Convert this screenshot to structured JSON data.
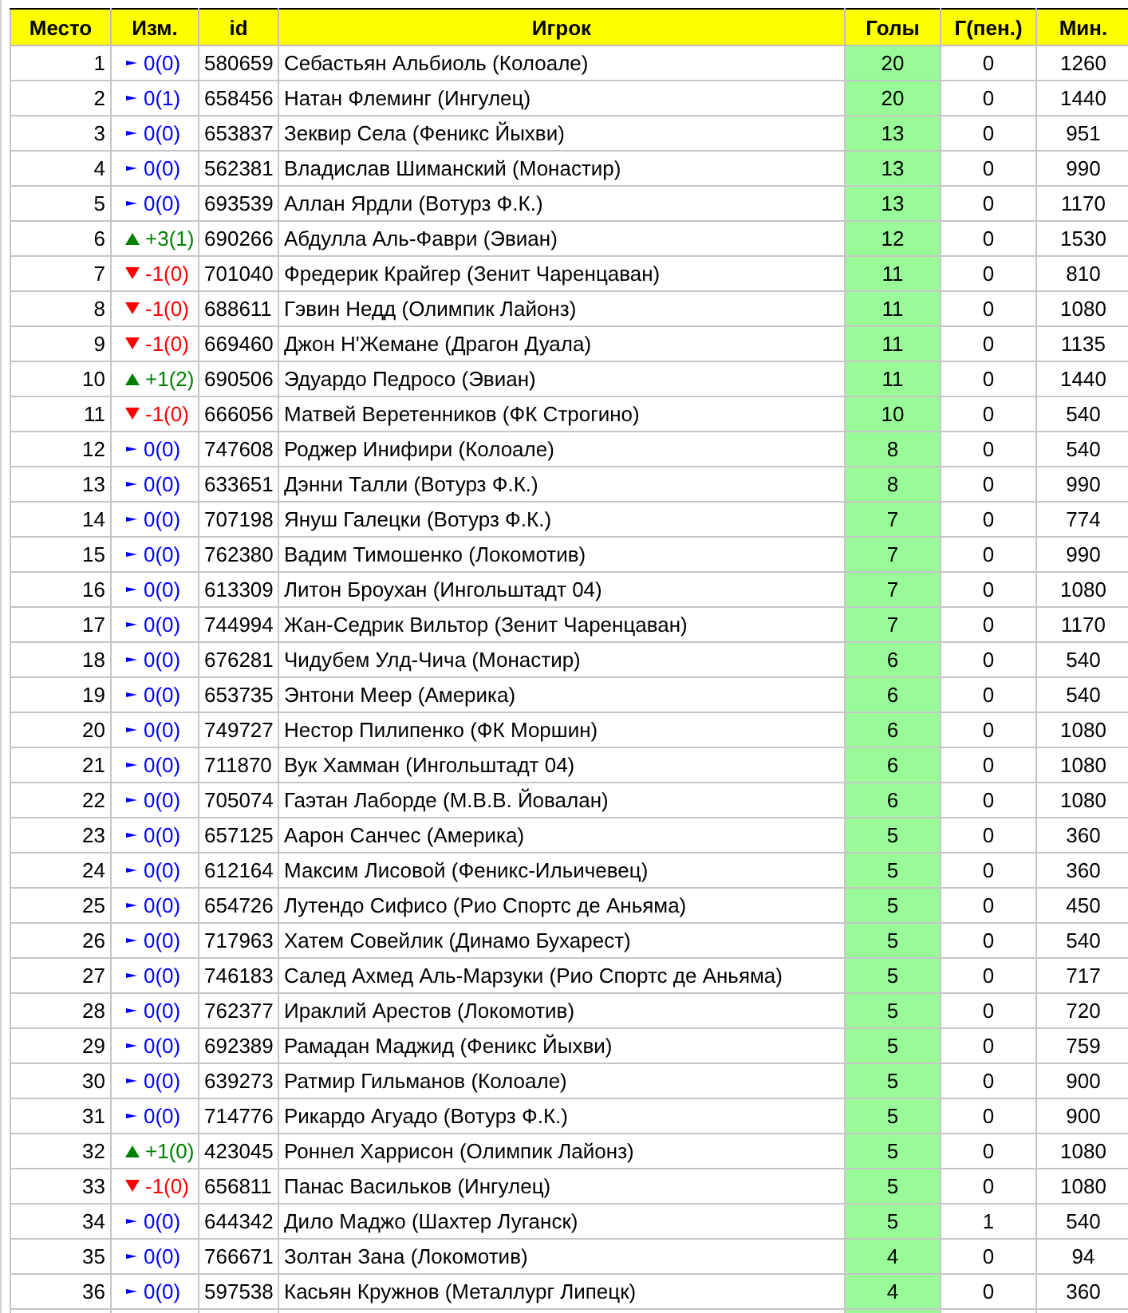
{
  "table": {
    "columns": [
      "Место",
      "Изм.",
      "id",
      "Игрок",
      "Голы",
      "Г(пен.)",
      "Мин."
    ],
    "rows": [
      {
        "place": "1",
        "change": {
          "kind": "same",
          "text": "0(0)"
        },
        "id": "580659",
        "player": "Себастьян Альбиоль (Колоале)",
        "goals": "20",
        "pen": "0",
        "min": "1260"
      },
      {
        "place": "2",
        "change": {
          "kind": "same",
          "text": "0(1)"
        },
        "id": "658456",
        "player": "Натан Флеминг (Ингулец)",
        "goals": "20",
        "pen": "0",
        "min": "1440"
      },
      {
        "place": "3",
        "change": {
          "kind": "same",
          "text": "0(0)"
        },
        "id": "653837",
        "player": "Зеквир Села (Феникс Йыхви)",
        "goals": "13",
        "pen": "0",
        "min": "951"
      },
      {
        "place": "4",
        "change": {
          "kind": "same",
          "text": "0(0)"
        },
        "id": "562381",
        "player": "Владислав Шиманский (Монастир)",
        "goals": "13",
        "pen": "0",
        "min": "990"
      },
      {
        "place": "5",
        "change": {
          "kind": "same",
          "text": "0(0)"
        },
        "id": "693539",
        "player": "Аллан Ярдли (Вотурз Ф.К.)",
        "goals": "13",
        "pen": "0",
        "min": "1170"
      },
      {
        "place": "6",
        "change": {
          "kind": "up",
          "text": "+3(1)"
        },
        "id": "690266",
        "player": "Абдулла Аль-Фаври (Эвиан)",
        "goals": "12",
        "pen": "0",
        "min": "1530"
      },
      {
        "place": "7",
        "change": {
          "kind": "down",
          "text": "-1(0)"
        },
        "id": "701040",
        "player": "Фредерик Крайгер (Зенит Чаренцаван)",
        "goals": "11",
        "pen": "0",
        "min": "810"
      },
      {
        "place": "8",
        "change": {
          "kind": "down",
          "text": "-1(0)"
        },
        "id": "688611",
        "player": "Гэвин Недд (Олимпик Лайонз)",
        "goals": "11",
        "pen": "0",
        "min": "1080"
      },
      {
        "place": "9",
        "change": {
          "kind": "down",
          "text": "-1(0)"
        },
        "id": "669460",
        "player": "Джон Н'Жемане (Драгон Дуала)",
        "goals": "11",
        "pen": "0",
        "min": "1135"
      },
      {
        "place": "10",
        "change": {
          "kind": "up",
          "text": "+1(2)"
        },
        "id": "690506",
        "player": "Эдуардо Педросо (Эвиан)",
        "goals": "11",
        "pen": "0",
        "min": "1440"
      },
      {
        "place": "11",
        "change": {
          "kind": "down",
          "text": "-1(0)"
        },
        "id": "666056",
        "player": "Матвей Веретенников (ФК Строгино)",
        "goals": "10",
        "pen": "0",
        "min": "540"
      },
      {
        "place": "12",
        "change": {
          "kind": "same",
          "text": "0(0)"
        },
        "id": "747608",
        "player": "Роджер Инифири (Колоале)",
        "goals": "8",
        "pen": "0",
        "min": "540"
      },
      {
        "place": "13",
        "change": {
          "kind": "same",
          "text": "0(0)"
        },
        "id": "633651",
        "player": "Дэнни Талли (Вотурз Ф.К.)",
        "goals": "8",
        "pen": "0",
        "min": "990"
      },
      {
        "place": "14",
        "change": {
          "kind": "same",
          "text": "0(0)"
        },
        "id": "707198",
        "player": "Януш Галецки (Вотурз Ф.К.)",
        "goals": "7",
        "pen": "0",
        "min": "774"
      },
      {
        "place": "15",
        "change": {
          "kind": "same",
          "text": "0(0)"
        },
        "id": "762380",
        "player": "Вадим Тимошенко (Локомотив)",
        "goals": "7",
        "pen": "0",
        "min": "990"
      },
      {
        "place": "16",
        "change": {
          "kind": "same",
          "text": "0(0)"
        },
        "id": "613309",
        "player": "Литон Броухан (Ингольштадт 04)",
        "goals": "7",
        "pen": "0",
        "min": "1080"
      },
      {
        "place": "17",
        "change": {
          "kind": "same",
          "text": "0(0)"
        },
        "id": "744994",
        "player": "Жан-Седрик Вильтор (Зенит Чаренцаван)",
        "goals": "7",
        "pen": "0",
        "min": "1170"
      },
      {
        "place": "18",
        "change": {
          "kind": "same",
          "text": "0(0)"
        },
        "id": "676281",
        "player": "Чидубем Улд-Чича (Монастир)",
        "goals": "6",
        "pen": "0",
        "min": "540"
      },
      {
        "place": "19",
        "change": {
          "kind": "same",
          "text": "0(0)"
        },
        "id": "653735",
        "player": "Энтони Меер (Америка)",
        "goals": "6",
        "pen": "0",
        "min": "540"
      },
      {
        "place": "20",
        "change": {
          "kind": "same",
          "text": "0(0)"
        },
        "id": "749727",
        "player": "Нестор Пилипенко (ФК Моршин)",
        "goals": "6",
        "pen": "0",
        "min": "1080"
      },
      {
        "place": "21",
        "change": {
          "kind": "same",
          "text": "0(0)"
        },
        "id": "711870",
        "player": "Вук Хамман (Ингольштадт 04)",
        "goals": "6",
        "pen": "0",
        "min": "1080"
      },
      {
        "place": "22",
        "change": {
          "kind": "same",
          "text": "0(0)"
        },
        "id": "705074",
        "player": "Гаэтан Лаборде (М.В.В. Йовалан)",
        "goals": "6",
        "pen": "0",
        "min": "1080"
      },
      {
        "place": "23",
        "change": {
          "kind": "same",
          "text": "0(0)"
        },
        "id": "657125",
        "player": "Аарон Санчес (Америка)",
        "goals": "5",
        "pen": "0",
        "min": "360"
      },
      {
        "place": "24",
        "change": {
          "kind": "same",
          "text": "0(0)"
        },
        "id": "612164",
        "player": "Максим Лисовой (Феникс-Ильичевец)",
        "goals": "5",
        "pen": "0",
        "min": "360"
      },
      {
        "place": "25",
        "change": {
          "kind": "same",
          "text": "0(0)"
        },
        "id": "654726",
        "player": "Лутендо Сифисо (Рио Спортс де Аньяма)",
        "goals": "5",
        "pen": "0",
        "min": "450"
      },
      {
        "place": "26",
        "change": {
          "kind": "same",
          "text": "0(0)"
        },
        "id": "717963",
        "player": "Хатем Совейлик (Динамо Бухарест)",
        "goals": "5",
        "pen": "0",
        "min": "540"
      },
      {
        "place": "27",
        "change": {
          "kind": "same",
          "text": "0(0)"
        },
        "id": "746183",
        "player": "Салед Ахмед Аль-Марзуки (Рио Спортс де Аньяма)",
        "goals": "5",
        "pen": "0",
        "min": "717"
      },
      {
        "place": "28",
        "change": {
          "kind": "same",
          "text": "0(0)"
        },
        "id": "762377",
        "player": "Ираклий Арестов (Локомотив)",
        "goals": "5",
        "pen": "0",
        "min": "720"
      },
      {
        "place": "29",
        "change": {
          "kind": "same",
          "text": "0(0)"
        },
        "id": "692389",
        "player": "Рамадан Маджид (Феникс Йыхви)",
        "goals": "5",
        "pen": "0",
        "min": "759"
      },
      {
        "place": "30",
        "change": {
          "kind": "same",
          "text": "0(0)"
        },
        "id": "639273",
        "player": "Ратмир Гильманов (Колоале)",
        "goals": "5",
        "pen": "0",
        "min": "900"
      },
      {
        "place": "31",
        "change": {
          "kind": "same",
          "text": "0(0)"
        },
        "id": "714776",
        "player": "Рикардо Агуадо (Вотурз Ф.К.)",
        "goals": "5",
        "pen": "0",
        "min": "900"
      },
      {
        "place": "32",
        "change": {
          "kind": "up",
          "text": "+1(0)"
        },
        "id": "423045",
        "player": "Роннел Харрисон (Олимпик Лайонз)",
        "goals": "5",
        "pen": "0",
        "min": "1080"
      },
      {
        "place": "33",
        "change": {
          "kind": "down",
          "text": "-1(0)"
        },
        "id": "656811",
        "player": "Панас Васильков (Ингулец)",
        "goals": "5",
        "pen": "0",
        "min": "1080"
      },
      {
        "place": "34",
        "change": {
          "kind": "same",
          "text": "0(0)"
        },
        "id": "644342",
        "player": "Дило Маджо (Шахтер Луганск)",
        "goals": "5",
        "pen": "1",
        "min": "540"
      },
      {
        "place": "35",
        "change": {
          "kind": "same",
          "text": "0(0)"
        },
        "id": "766671",
        "player": "Золтан Зана (Локомотив)",
        "goals": "4",
        "pen": "0",
        "min": "94"
      },
      {
        "place": "36",
        "change": {
          "kind": "same",
          "text": "0(0)"
        },
        "id": "597538",
        "player": "Касьян Кружнов (Металлург Липецк)",
        "goals": "4",
        "pen": "0",
        "min": "360"
      }
    ]
  }
}
